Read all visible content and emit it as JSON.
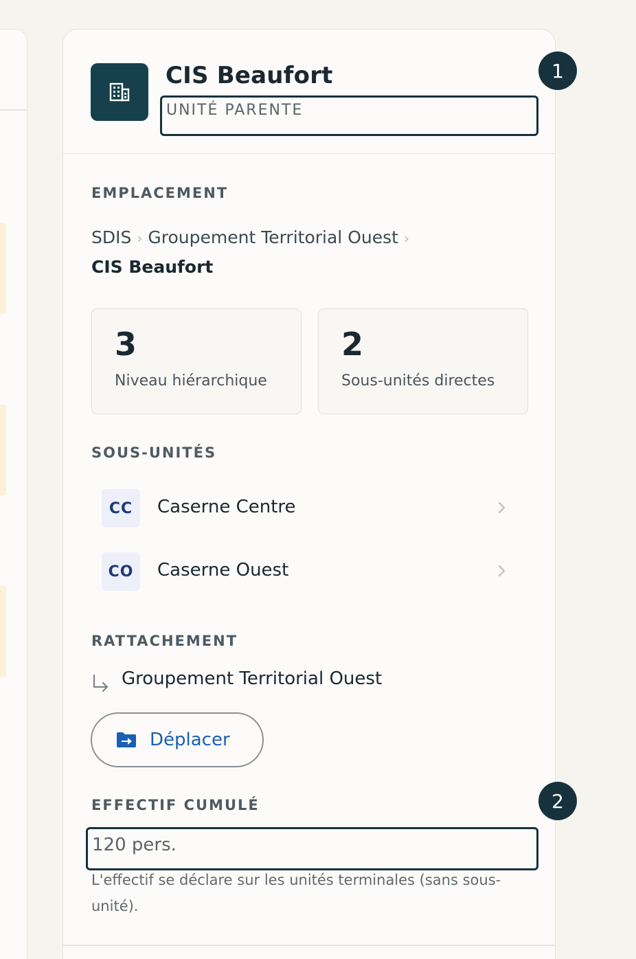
{
  "header": {
    "title": "CIS Beaufort",
    "parent_field_placeholder": "UNITÉ PARENTE",
    "unit_icon": "building-icon"
  },
  "badges": [
    "1",
    "2"
  ],
  "location": {
    "label": "EMPLACEMENT",
    "breadcrumb": [
      "SDIS",
      "Groupement Territorial Ouest"
    ],
    "current": "CIS Beaufort"
  },
  "stats": [
    {
      "value": "3",
      "label": "Niveau hiérarchique"
    },
    {
      "value": "2",
      "label": "Sous-unités directes"
    }
  ],
  "subunits": {
    "label": "SOUS-UNITÉS",
    "items": [
      {
        "abbr": "CC",
        "name": "Caserne Centre"
      },
      {
        "abbr": "CO",
        "name": "Caserne Ouest"
      }
    ]
  },
  "attachment": {
    "label": "RATTACHEMENT",
    "parent": "Groupement Territorial Ouest",
    "move_label": "Déplacer"
  },
  "effectif": {
    "label": "EFFECTIF CUMULÉ",
    "value": "120 pers.",
    "hint": "L'effectif se déclare sur les unités terminales (sans sous-unité)."
  },
  "colors": {
    "accent_dark": "#17404d",
    "badge": "#17323d",
    "link_blue": "#1a5fb4",
    "abbr_bg": "#edf0f8"
  }
}
